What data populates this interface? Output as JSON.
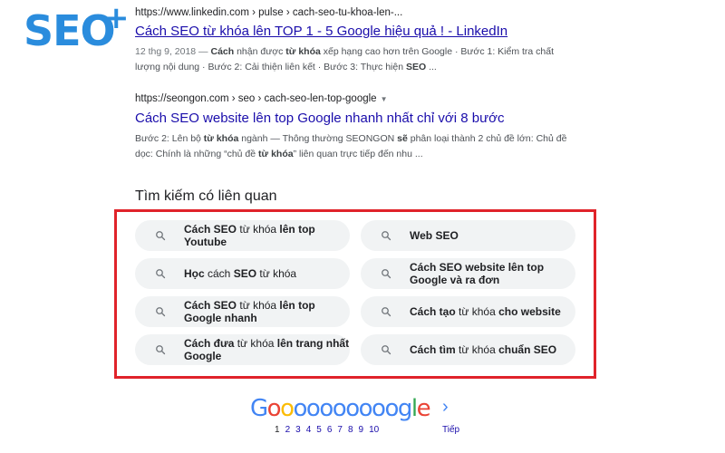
{
  "logo": {
    "text": "SEO",
    "plus": "+"
  },
  "results": [
    {
      "url": "https://www.linkedin.com › pulse › cach-seo-tu-khoa-len-...",
      "title": "Cách SEO từ khóa lên TOP 1 - 5 Google hiệu quả ! - LinkedIn",
      "snippet": [
        {
          "t": "12 thg 9, 2018 — ",
          "s": "date"
        },
        {
          "t": "Cách",
          "s": "b"
        },
        {
          "t": " nhận được ",
          "s": "n"
        },
        {
          "t": "từ khóa",
          "s": "b"
        },
        {
          "t": " xếp hạng cao hơn trên Google · Bước 1: Kiểm tra chất lượng nội dung · Bước 2: Cải thiện liên kết · Bước 3: Thực hiện ",
          "s": "n"
        },
        {
          "t": "SEO",
          "s": "b"
        },
        {
          "t": " ...",
          "s": "n"
        }
      ]
    },
    {
      "url": "https://seongon.com › seo › cach-seo-len-top-google",
      "caret": "▼",
      "title": "Cách SEO website lên top Google nhanh nhất chỉ với 8 bước",
      "snippet": [
        {
          "t": "Bước 2: Lên bộ ",
          "s": "n"
        },
        {
          "t": "từ khóa",
          "s": "b"
        },
        {
          "t": " ngành — Thông thường SEONGON ",
          "s": "n"
        },
        {
          "t": "sẽ",
          "s": "b"
        },
        {
          "t": " phân loại thành 2 chủ đề lớn: Chủ đề dọc: Chính là những “chủ đề ",
          "s": "n"
        },
        {
          "t": "từ khóa",
          "s": "b"
        },
        {
          "t": "” liên quan trực tiếp đến nhu ...",
          "s": "n"
        }
      ]
    }
  ],
  "related": {
    "title": "Tìm kiếm có liên quan",
    "items": [
      [
        {
          "t": "Cách SEO",
          "b": true
        },
        {
          "t": " từ khóa ",
          "b": false
        },
        {
          "t": "lên top Youtube",
          "b": true
        }
      ],
      [
        {
          "t": "Web SEO",
          "b": true
        }
      ],
      [
        {
          "t": "Học",
          "b": true
        },
        {
          "t": " cách ",
          "b": false
        },
        {
          "t": "SEO",
          "b": true
        },
        {
          "t": " từ khóa",
          "b": false
        }
      ],
      [
        {
          "t": "Cách SEO website lên top Google và ra đơn",
          "b": true
        }
      ],
      [
        {
          "t": "Cách SEO",
          "b": true
        },
        {
          "t": " từ khóa ",
          "b": false
        },
        {
          "t": "lên top Google nhanh",
          "b": true
        }
      ],
      [
        {
          "t": "Cách tạo",
          "b": true
        },
        {
          "t": " từ khóa ",
          "b": false
        },
        {
          "t": "cho website",
          "b": true
        }
      ],
      [
        {
          "t": "Cách đưa",
          "b": true
        },
        {
          "t": " từ khóa ",
          "b": false
        },
        {
          "t": "lên trang nhất Google",
          "b": true
        }
      ],
      [
        {
          "t": "Cách tìm",
          "b": true
        },
        {
          "t": " từ khóa ",
          "b": false
        },
        {
          "t": "chuẩn SEO",
          "b": true
        }
      ]
    ]
  },
  "pagination": {
    "letters": [
      {
        "c": "G",
        "color": "#4285f4"
      },
      {
        "c": "o",
        "color": "#ea4335"
      },
      {
        "c": "o",
        "color": "#fbbc05"
      },
      {
        "c": "o",
        "color": "#4285f4"
      },
      {
        "c": "o",
        "color": "#4285f4"
      },
      {
        "c": "o",
        "color": "#4285f4"
      },
      {
        "c": "o",
        "color": "#4285f4"
      },
      {
        "c": "o",
        "color": "#4285f4"
      },
      {
        "c": "o",
        "color": "#4285f4"
      },
      {
        "c": "o",
        "color": "#4285f4"
      },
      {
        "c": "o",
        "color": "#4285f4"
      },
      {
        "c": "g",
        "color": "#4285f4"
      },
      {
        "c": "l",
        "color": "#34a853"
      },
      {
        "c": "e",
        "color": "#ea4335"
      }
    ],
    "arrow": "›",
    "pages": [
      "1",
      "2",
      "3",
      "4",
      "5",
      "6",
      "7",
      "8",
      "9",
      "10"
    ],
    "current": "1",
    "next_label": "Tiếp"
  },
  "colors": {
    "link": "#1a0dab",
    "accent_box": "#e0232a",
    "chip_bg": "#f1f3f4",
    "logo": "#2a8cdd"
  },
  "icons": {
    "chip_icon": "search-icon"
  }
}
